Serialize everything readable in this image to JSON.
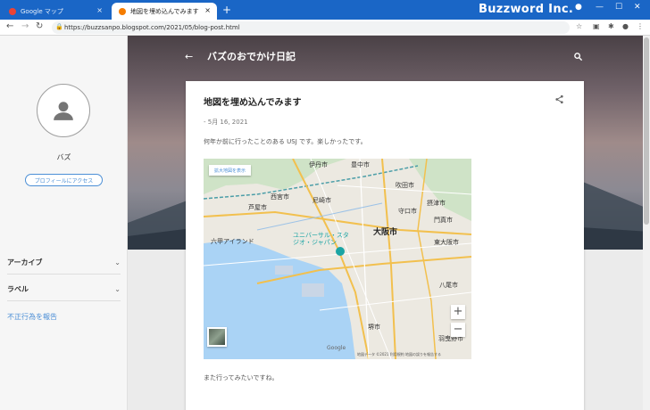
{
  "browser": {
    "tabs": [
      {
        "title": "Google マップ",
        "color": "#ea4335"
      },
      {
        "title": "地図を埋め込んでみます",
        "color": "#f57c00"
      }
    ],
    "new_tab": "+",
    "close": "×",
    "brand": "Buzzword Inc.",
    "window_controls": [
      "—",
      "☐",
      "✕"
    ],
    "url": "https://buzzsanpo.blogspot.com/2021/05/blog-post.html"
  },
  "blog": {
    "title": "バズのおでかけ日記"
  },
  "sidebar": {
    "username": "バズ",
    "profile_button": "プロフィールにアクセス",
    "items": [
      {
        "label": "アーカイブ"
      },
      {
        "label": "ラベル"
      }
    ],
    "report_link": "不正行為を報告"
  },
  "post": {
    "title": "地図を埋め込んでみます",
    "date": "- 5月 16, 2021",
    "body": "何年か前に行ったことのある USJ です。楽しかったです。",
    "footer": "また行ってみたいですね。"
  },
  "map": {
    "enlarge_button": "拡大地図を表示",
    "labels": [
      "伊丹市",
      "豊中市",
      "西宮市",
      "尼崎市",
      "芦屋市",
      "吹田市",
      "摂津市",
      "大阪市",
      "東大阪市",
      "六甲アイランド",
      "ユニバーサル・スタジオ・ジャパン",
      "八尾市",
      "堺市",
      "羽曳野市",
      "門真市",
      "守口市"
    ],
    "zoom_in": "+",
    "zoom_out": "−",
    "google": "Google",
    "attribution": "地図データ ©2021  利用規約  地図の誤りを報告する"
  },
  "colors": {
    "tabbar": "#1a66c6",
    "accent_link": "#4c8fd6"
  }
}
